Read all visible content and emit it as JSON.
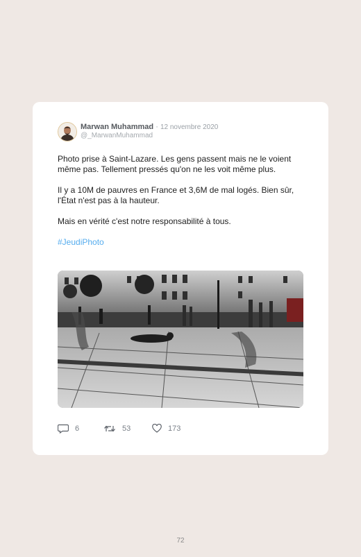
{
  "tweet": {
    "author_name": "Marwan Muhammad",
    "date": "12 novembre 2020",
    "handle": "@_MarwanMuhammad",
    "paragraphs": [
      "Photo prise à Saint-Lazare. Les gens passent mais ne le voient même pas. Tellement pressés qu'on ne les voit même plus.",
      "Il y a 10M de pauvres en France et 3,6M de mal logés. Bien sûr, l'État n'est pas à la hauteur.",
      "Mais en vérité c'est notre responsabilité à tous."
    ],
    "hashtag": "#JeudiPhoto",
    "actions": {
      "replies": "6",
      "retweets": "53",
      "likes": "173"
    }
  },
  "icons": {
    "reply": "speech-bubble-icon",
    "retweet": "retweet-icon",
    "like": "heart-icon"
  },
  "colors": {
    "background": "#efe8e4",
    "card": "#ffffff",
    "hashtag": "#55acee",
    "avatar_border": "#e0c79a"
  },
  "page": {
    "number": "72"
  }
}
